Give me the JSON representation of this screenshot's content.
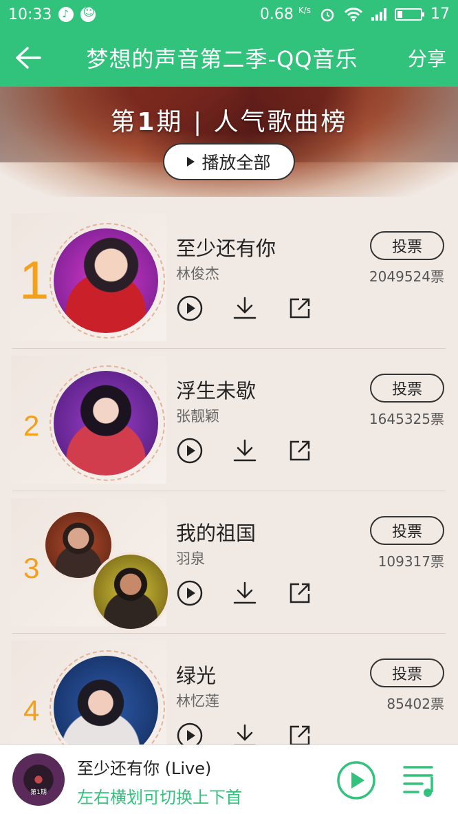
{
  "statusbar": {
    "time": "10:33",
    "speed": "0.68",
    "speed_unit": "K/s",
    "battery": "17"
  },
  "header": {
    "title": "梦想的声音第二季-QQ音乐",
    "share_label": "分享"
  },
  "banner": {
    "title_prefix": "第",
    "issue": "1",
    "title_suffix": "期 | 人气歌曲榜",
    "play_all_label": "播放全部"
  },
  "songs": [
    {
      "rank": "1",
      "title": "至少还有你",
      "artist": "林俊杰",
      "vote_label": "投票",
      "votes": "2049524票"
    },
    {
      "rank": "2",
      "title": "浮生未歇",
      "artist": "张靓颖",
      "vote_label": "投票",
      "votes": "1645325票"
    },
    {
      "rank": "3",
      "title": "我的祖国",
      "artist": "羽泉",
      "vote_label": "投票",
      "votes": "109317票"
    },
    {
      "rank": "4",
      "title": "绿光",
      "artist": "林忆莲",
      "vote_label": "投票",
      "votes": "85402票"
    }
  ],
  "player": {
    "cover_text": "第1期",
    "title": "至少还有你 (Live)",
    "hint": "左右横划可切换上下首"
  },
  "colors": {
    "accent": "#31c27c",
    "rank": "#f3a01d",
    "background": "#f1e9e4"
  }
}
